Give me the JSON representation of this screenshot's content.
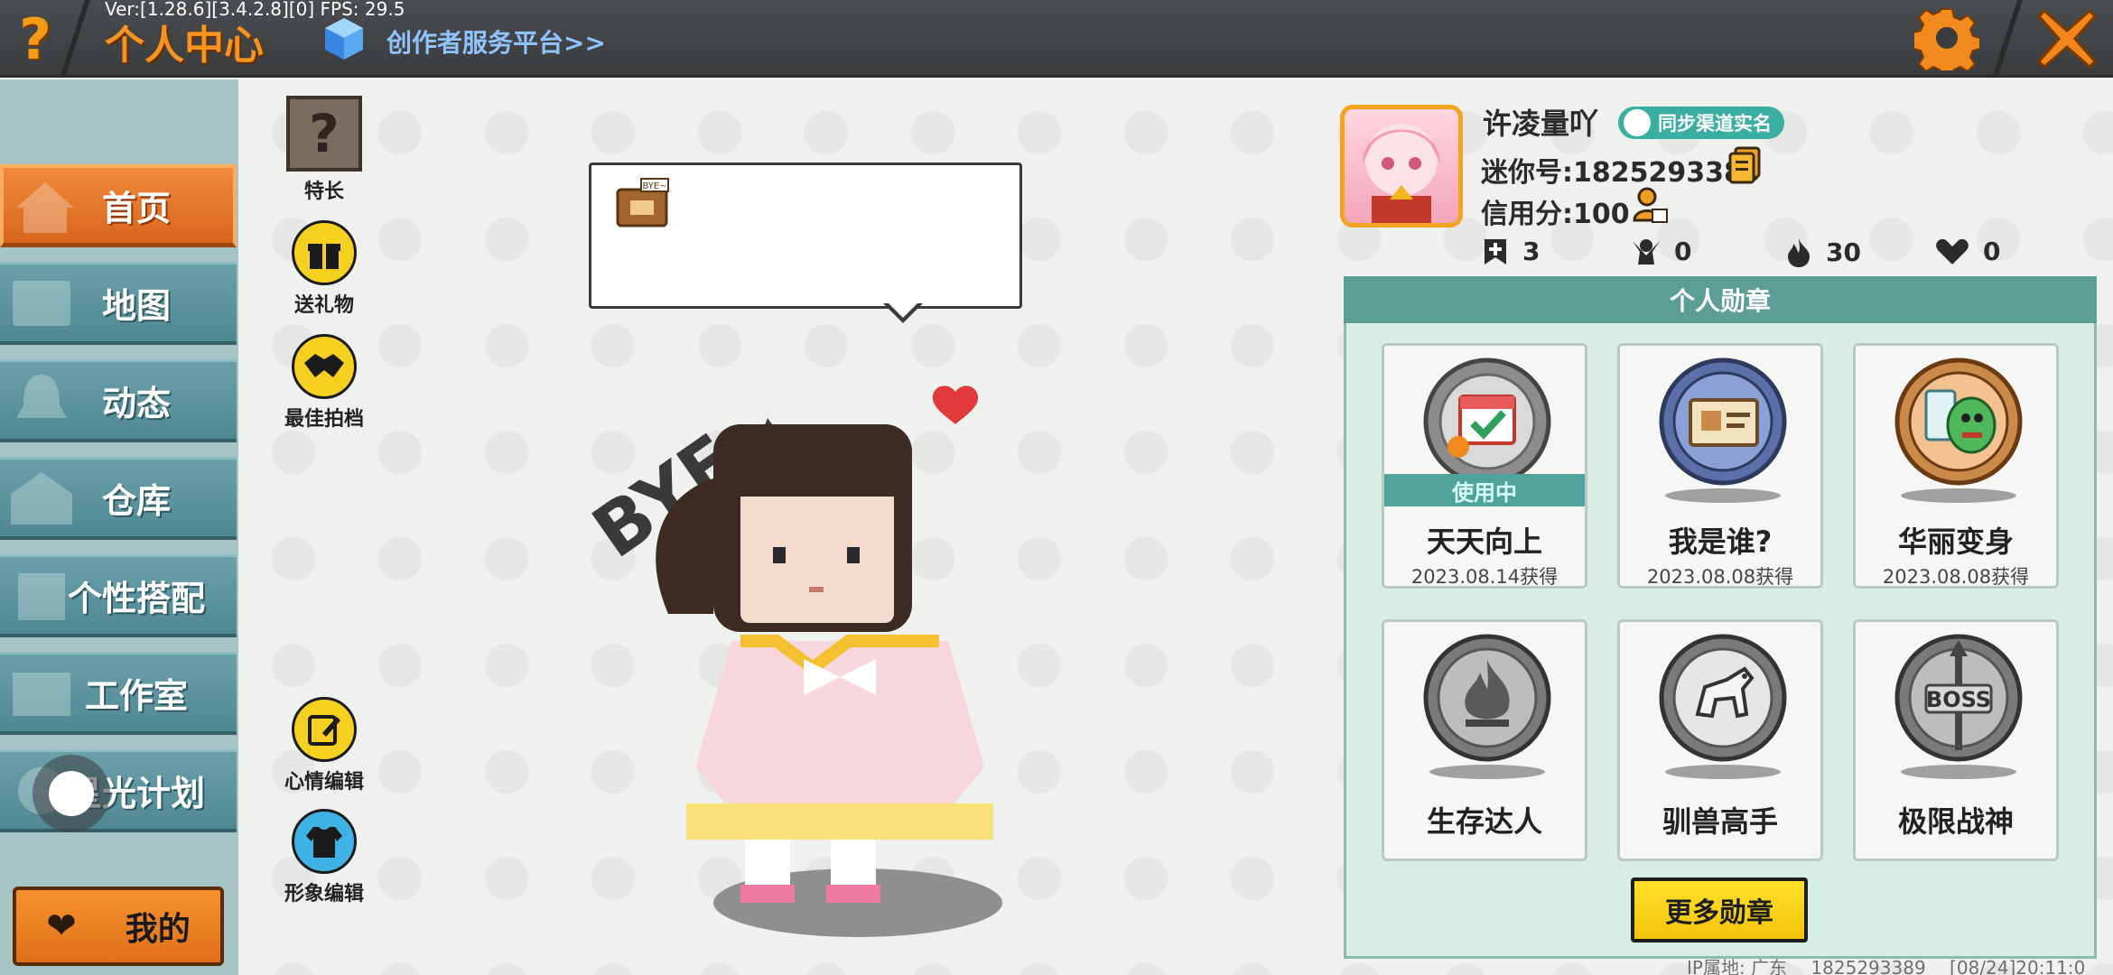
{
  "topbar": {
    "help_label": "?",
    "version": "Ver:[1.28.6][3.4.2.8][0] FPS: 29.5",
    "title": "个人中心",
    "creator_link": "创作者服务平台>>",
    "settings_icon": "gear-icon",
    "close_icon": "close-icon",
    "accent": "#f7931e"
  },
  "sidebar": {
    "items": [
      {
        "label": "首页",
        "icon": "home-icon",
        "active": true
      },
      {
        "label": "地图",
        "icon": "map-icon",
        "active": false
      },
      {
        "label": "动态",
        "icon": "bell-icon",
        "active": false
      },
      {
        "label": "仓库",
        "icon": "warehouse-icon",
        "active": false
      },
      {
        "label": "个性搭配",
        "icon": "outfit-icon",
        "active": false
      },
      {
        "label": "工作室",
        "icon": "studio-icon",
        "active": false
      },
      {
        "label": "星光计划",
        "icon": "star-plan-icon",
        "active": false
      }
    ],
    "me_label": "我的"
  },
  "actions": {
    "specialty": "特长",
    "gift": "送礼物",
    "partner": "最佳拍档",
    "mood_edit": "心情编辑",
    "avatar_edit": "形象编辑"
  },
  "speech": {
    "sticker_text": "BYE~",
    "avatar_text": "BYE~"
  },
  "profile": {
    "username": "许凌量吖",
    "realname_badge": "同步渠道实名",
    "mini_id": "迷你号:1825293389",
    "credit": "信用分:100",
    "stats": [
      {
        "icon": "add-friend-icon",
        "value": "3"
      },
      {
        "icon": "followers-icon",
        "value": "0"
      },
      {
        "icon": "flame-icon",
        "value": "30"
      },
      {
        "icon": "heart-icon",
        "value": "0"
      }
    ]
  },
  "medals": {
    "header": "个人勋章",
    "items": [
      {
        "name": "天天向上",
        "date": "2023.08.14获得",
        "in_use": "使用中",
        "icon": "calendar-medal-icon"
      },
      {
        "name": "我是谁?",
        "date": "2023.08.08获得",
        "icon": "id-card-medal-icon"
      },
      {
        "name": "华丽变身",
        "date": "2023.08.08获得",
        "icon": "dino-medal-icon"
      },
      {
        "name": "生存达人",
        "date": "",
        "icon": "fire-medal-icon"
      },
      {
        "name": "驯兽高手",
        "date": "",
        "icon": "horse-medal-icon"
      },
      {
        "name": "极限战神",
        "date": "",
        "icon": "boss-medal-icon"
      }
    ],
    "more_label": "更多勋章"
  },
  "footer": {
    "ip": "IP属地: 广东",
    "uid": "1825293389",
    "time": "[08/24]20:11:0"
  }
}
